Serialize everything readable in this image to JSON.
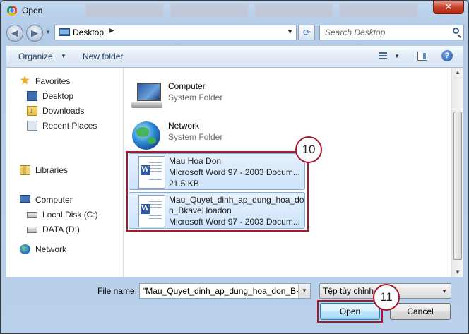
{
  "window": {
    "title": "Open",
    "close_label": "✕"
  },
  "address": {
    "location": "Desktop",
    "search_placeholder": "Search Desktop"
  },
  "toolbar": {
    "organize": "Organize",
    "new_folder": "New folder",
    "help": "?"
  },
  "nav": {
    "favorites": "Favorites",
    "desktop": "Desktop",
    "downloads": "Downloads",
    "recent": "Recent Places",
    "libraries": "Libraries",
    "computer": "Computer",
    "local_disk": "Local Disk (C:)",
    "data_disk": "DATA (D:)",
    "network": "Network"
  },
  "files": [
    {
      "name": "Computer",
      "sub1": "System Folder"
    },
    {
      "name": "Network",
      "sub1": "System Folder"
    },
    {
      "name": "Mau Hoa Don",
      "sub1": "Microsoft Word 97 - 2003 Docum...",
      "sub2": "21.5 KB"
    },
    {
      "name": "Mau_Quyet_dinh_ap_dung_hoa_do",
      "name2": "n_BkaveHoadon",
      "sub1": "Microsoft Word 97 - 2003 Docum..."
    }
  ],
  "annotations": {
    "step10": "10",
    "step11": "11"
  },
  "bottom": {
    "file_name_label": "File name:",
    "file_name_value": "\"Mau_Quyet_dinh_ap_dung_hoa_don_Bkav",
    "file_type": "Tệp tùy chỉnh",
    "open": "Open",
    "cancel": "Cancel"
  },
  "colors": {
    "annotation_red": "#a8182d",
    "selection": "#cde4fb"
  }
}
